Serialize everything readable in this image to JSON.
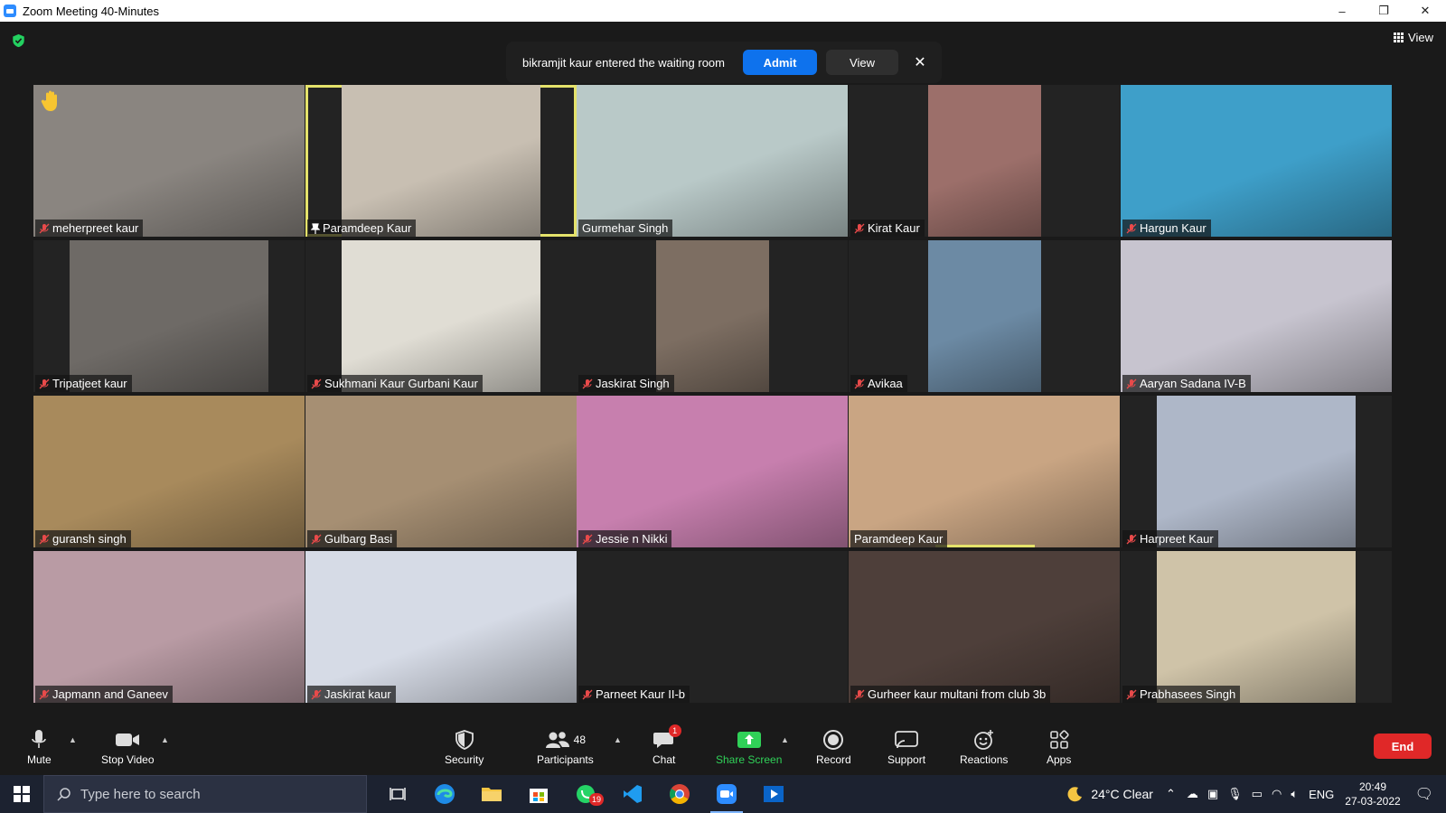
{
  "window": {
    "title": "Zoom Meeting 40-Minutes",
    "controls": [
      "–",
      "❐",
      "✕"
    ]
  },
  "header": {
    "view_label": "View"
  },
  "notice": {
    "message": "bikramjit kaur entered the waiting room",
    "admit_label": "Admit",
    "view_label": "View",
    "close_glyph": "✕"
  },
  "participants": [
    {
      "name": "meherpreet kaur",
      "muted": true,
      "bg": "#8a8580",
      "hand": true
    },
    {
      "name": "Paramdeep Kaur",
      "muted": false,
      "pinned": true,
      "bg": "#c8bfb2",
      "active": true
    },
    {
      "name": "Gurmehar Singh",
      "muted": false,
      "bg": "#b9c9c8"
    },
    {
      "name": "Kirat Kaur",
      "muted": true,
      "bg": "#9c6f6a"
    },
    {
      "name": "Hargun Kaur",
      "muted": true,
      "bg": "#3e9fc9"
    },
    {
      "name": "Tripatjeet kaur",
      "muted": true,
      "bg": "#6e6a66"
    },
    {
      "name": "Sukhmani Kaur Gurbani Kaur",
      "muted": true,
      "bg": "#e0ddd4"
    },
    {
      "name": "Jaskirat Singh",
      "muted": true,
      "bg": "#7d6e62"
    },
    {
      "name": "Avikaa",
      "muted": true,
      "bg": "#6c8aa4"
    },
    {
      "name": "Aaryan Sadana IV-B",
      "muted": true,
      "bg": "#c7c4cf"
    },
    {
      "name": "guransh singh",
      "muted": true,
      "bg": "#a88a5c"
    },
    {
      "name": "Gulbarg Basi",
      "muted": true,
      "bg": "#a68f73"
    },
    {
      "name": "Jessie n Nikki",
      "muted": true,
      "bg": "#c77fae"
    },
    {
      "name": "Paramdeep Kaur",
      "muted": false,
      "bg": "#c9a583",
      "speaking": true
    },
    {
      "name": "Harpreet Kaur",
      "muted": true,
      "bg": "#aeb7c8"
    },
    {
      "name": "Japmann and Ganeev",
      "muted": true,
      "bg": "#b99ba4"
    },
    {
      "name": "Jaskirat kaur",
      "muted": true,
      "bg": "#d6dbe6"
    },
    {
      "name": "Parneet Kaur II-b",
      "muted": true,
      "bg": "#232323",
      "video_off": true
    },
    {
      "name": "Gurheer kaur multani from club 3b",
      "muted": true,
      "bg": "#4e3f3a"
    },
    {
      "name": "Prabhasees Singh",
      "muted": true,
      "bg": "#cfc3a8"
    }
  ],
  "toolbar": {
    "mute_label": "Mute",
    "stop_video_label": "Stop Video",
    "security_label": "Security",
    "participants_label": "Participants",
    "participants_count": "48",
    "chat_label": "Chat",
    "chat_badge": "1",
    "share_label": "Share Screen",
    "record_label": "Record",
    "support_label": "Support",
    "reactions_label": "Reactions",
    "apps_label": "Apps",
    "end_label": "End"
  },
  "taskbar": {
    "search_placeholder": "Type here to search",
    "whatsapp_badge": "19",
    "weather": "24°C  Clear",
    "language": "ENG",
    "time": "20:49",
    "date": "27-03-2022"
  },
  "colors": {
    "accent_blue": "#0e72ed",
    "end_red": "#e02828",
    "share_green": "#30d158",
    "active_speaker": "#e4e26b"
  }
}
